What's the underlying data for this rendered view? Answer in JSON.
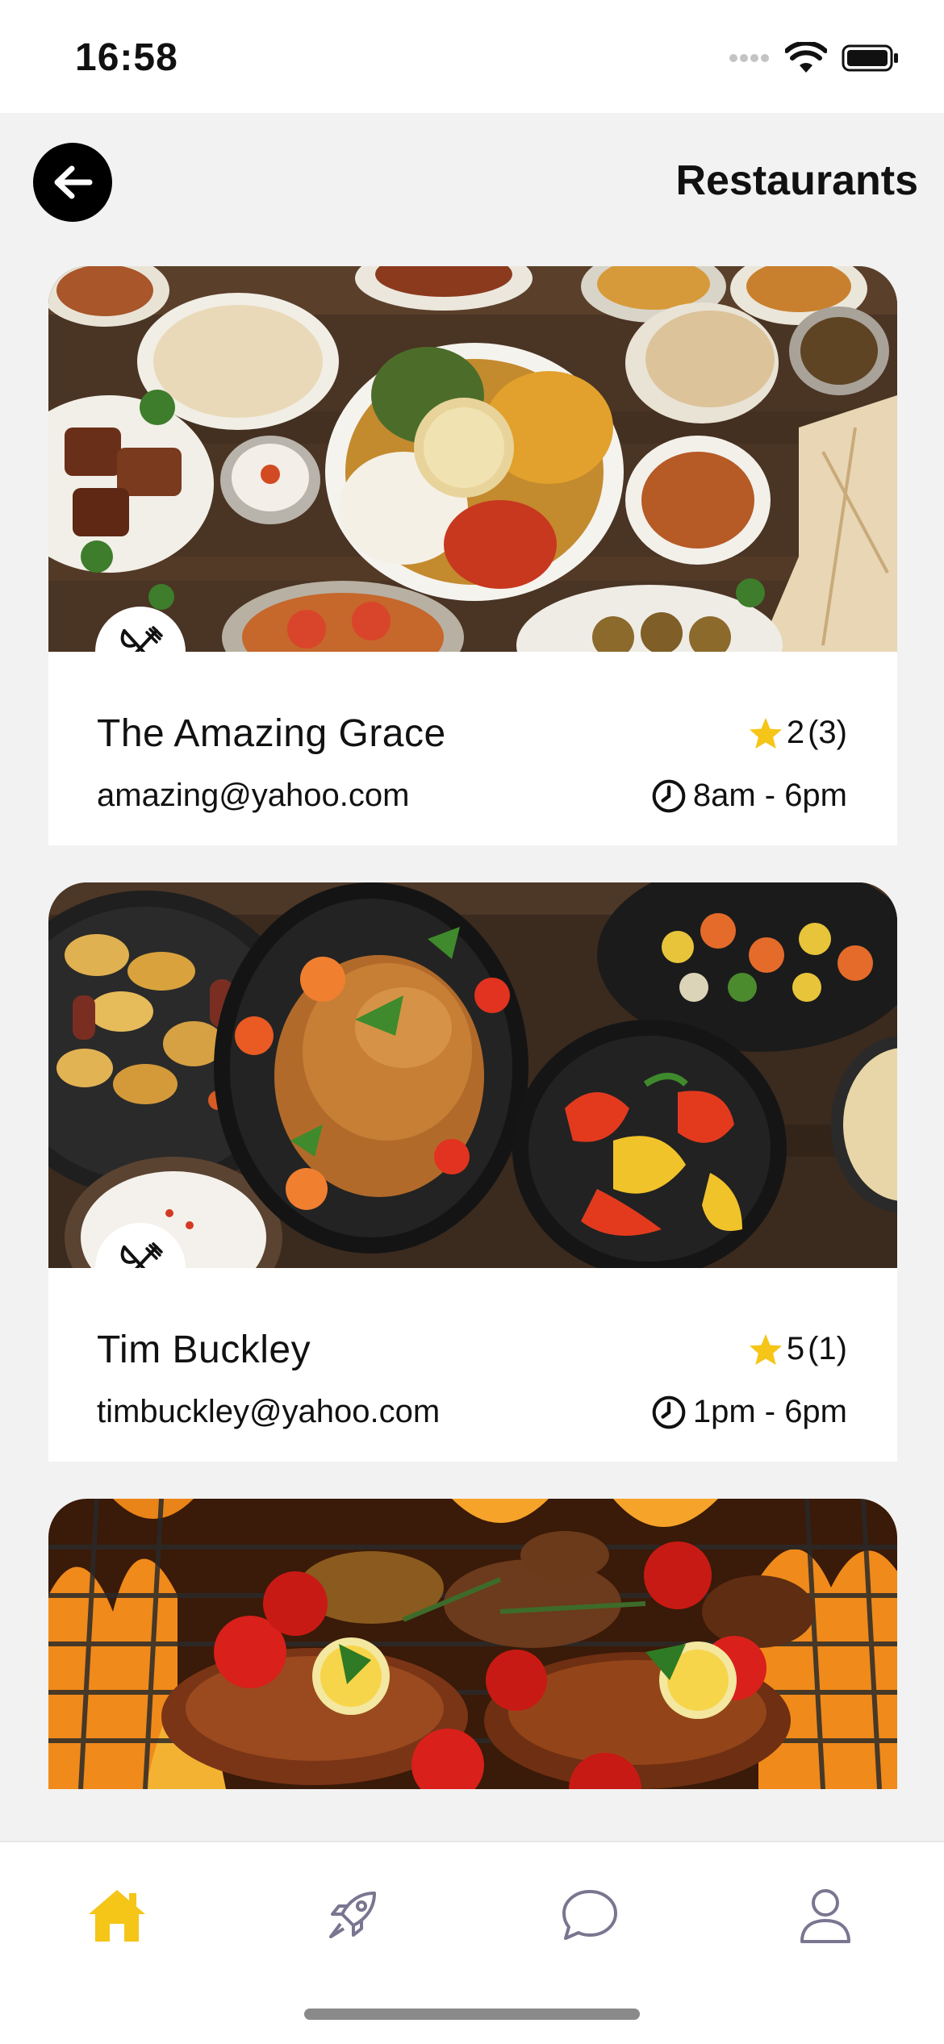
{
  "status_bar": {
    "time": "16:58"
  },
  "header": {
    "title": "Restaurants",
    "back_icon": "arrow-left-icon"
  },
  "restaurants": [
    {
      "name": "The Amazing Grace",
      "email": "amazing@yahoo.com",
      "rating": "2",
      "reviews": "(3)",
      "hours": "8am - 6pm",
      "image": "middle-eastern-platter"
    },
    {
      "name": "Tim Buckley",
      "email": "timbuckley@yahoo.com",
      "rating": "5",
      "reviews": "(1)",
      "hours": "1pm - 6pm",
      "image": "roast-chicken-vegetables"
    },
    {
      "image": "grilled-chicken-barbecue"
    }
  ],
  "bottom_nav": {
    "items": [
      {
        "name": "home",
        "icon": "home-icon",
        "active": true
      },
      {
        "name": "explore",
        "icon": "rocket-icon",
        "active": false
      },
      {
        "name": "chat",
        "icon": "chat-bubble-icon",
        "active": false
      },
      {
        "name": "profile",
        "icon": "user-icon",
        "active": false
      }
    ]
  },
  "colors": {
    "accent": "#F5C518",
    "background": "#F2F2F2",
    "nav_inactive": "#7A7590"
  }
}
